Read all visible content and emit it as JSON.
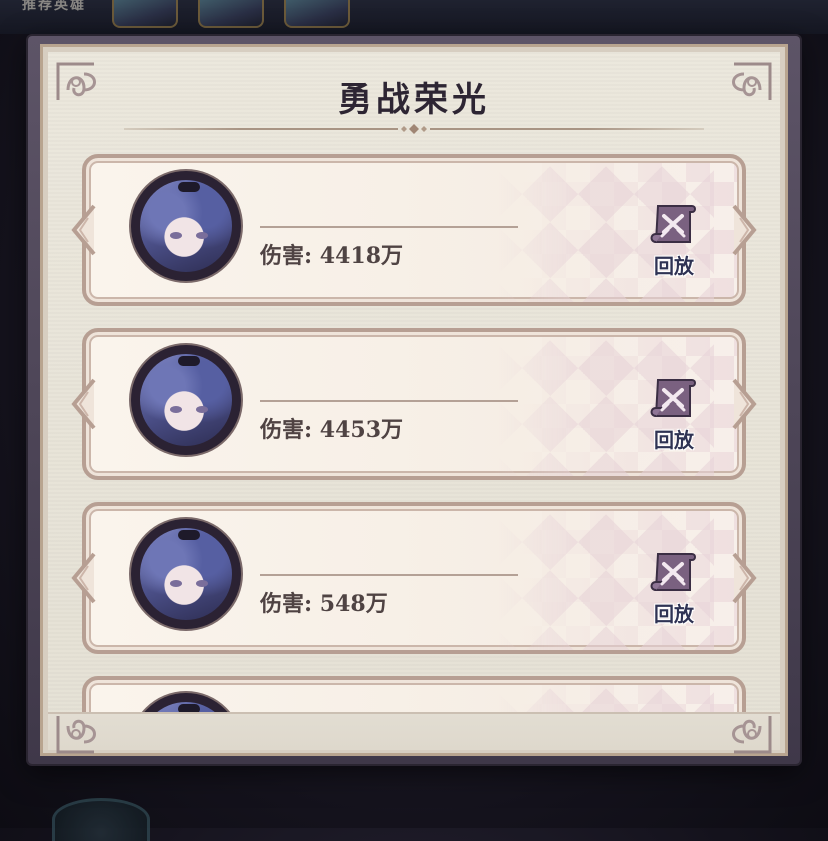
{
  "background": {
    "top_label": "推荐英雄"
  },
  "dialog": {
    "title": "勇战荣光"
  },
  "records": [
    {
      "damage_label": "伤害: 4418万",
      "replay_label": "回放"
    },
    {
      "damage_label": "伤害: 4453万",
      "replay_label": "回放"
    },
    {
      "damage_label": "伤害: 548万",
      "replay_label": "回放"
    },
    {
      "damage_label": "",
      "replay_label": ""
    }
  ],
  "colors": {
    "frame": "#4a4255",
    "panel": "#e8e4d9",
    "card_border": "#b79f93",
    "title_text": "#2d2533",
    "damage_text": "#4f4343",
    "replay_icon": "#7a6180"
  }
}
